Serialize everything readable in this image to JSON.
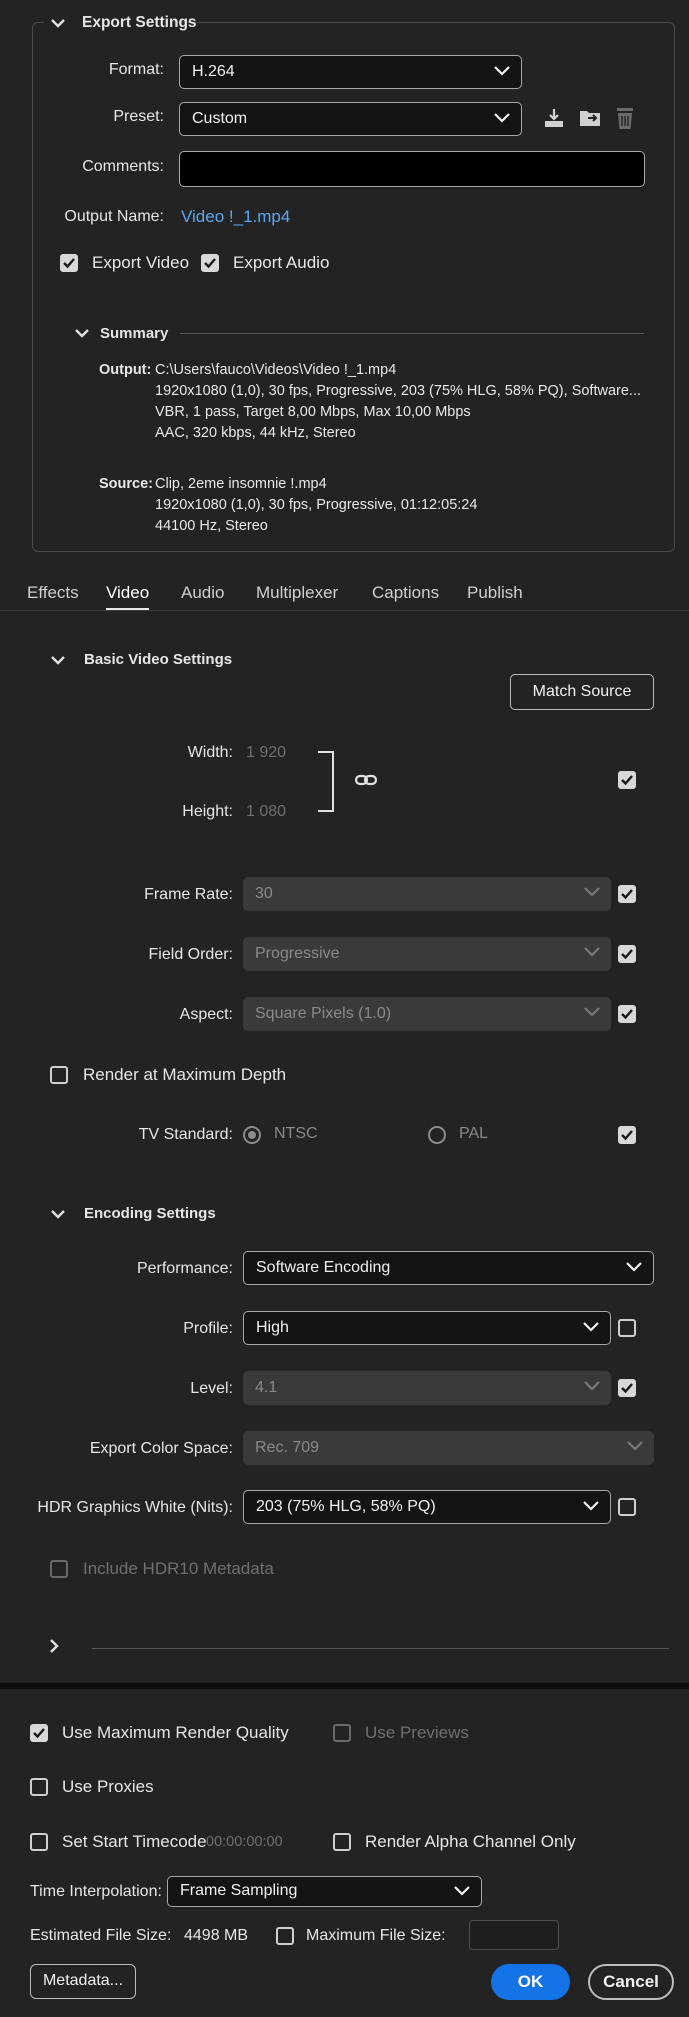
{
  "export_settings": {
    "title": "Export Settings",
    "format_label": "Format:",
    "format_value": "H.264",
    "preset_label": "Preset:",
    "preset_value": "Custom",
    "comments_label": "Comments:",
    "comments_value": "",
    "output_name_label": "Output Name:",
    "output_name_value": "Video !_1.mp4",
    "export_video_label": "Export Video",
    "export_video_checked": true,
    "export_audio_label": "Export Audio",
    "export_audio_checked": true,
    "summary": {
      "title": "Summary",
      "output_label": "Output:",
      "output_lines": [
        "C:\\Users\\fauco\\Videos\\Video !_1.mp4",
        "1920x1080 (1,0), 30 fps, Progressive, 203 (75% HLG, 58% PQ), Software...",
        "VBR, 1 pass, Target 8,00 Mbps, Max 10,00 Mbps",
        "AAC, 320 kbps, 44 kHz, Stereo"
      ],
      "source_label": "Source:",
      "source_lines": [
        "Clip, 2eme insomnie !.mp4",
        "1920x1080 (1,0), 30 fps, Progressive, 01:12:05:24",
        "44100 Hz, Stereo"
      ]
    }
  },
  "tabs": [
    {
      "label": "Effects",
      "active": false
    },
    {
      "label": "Video",
      "active": true
    },
    {
      "label": "Audio",
      "active": false
    },
    {
      "label": "Multiplexer",
      "active": false
    },
    {
      "label": "Captions",
      "active": false
    },
    {
      "label": "Publish",
      "active": false
    }
  ],
  "basic_video": {
    "title": "Basic Video Settings",
    "match_source_label": "Match Source",
    "width_label": "Width:",
    "width_value": "1 920",
    "height_label": "Height:",
    "height_value": "1 080",
    "frame_rate_label": "Frame Rate:",
    "frame_rate_value": "30",
    "field_order_label": "Field Order:",
    "field_order_value": "Progressive",
    "aspect_label": "Aspect:",
    "aspect_value": "Square Pixels (1.0)",
    "render_max_depth_label": "Render at Maximum Depth",
    "tv_standard_label": "TV Standard:",
    "ntsc_label": "NTSC",
    "pal_label": "PAL"
  },
  "encoding": {
    "title": "Encoding Settings",
    "performance_label": "Performance:",
    "performance_value": "Software Encoding",
    "profile_label": "Profile:",
    "profile_value": "High",
    "level_label": "Level:",
    "level_value": "4.1",
    "color_space_label": "Export Color Space:",
    "color_space_value": "Rec. 709",
    "hdr_white_label": "HDR Graphics White (Nits):",
    "hdr_white_value": "203 (75% HLG, 58% PQ)",
    "hdr10_label": "Include HDR10 Metadata"
  },
  "bottom": {
    "use_max_render_label": "Use Maximum Render Quality",
    "use_previews_label": "Use Previews",
    "use_proxies_label": "Use Proxies",
    "set_start_tc_label": "Set Start Timecode",
    "start_tc_value": "00:00:00:00",
    "render_alpha_label": "Render Alpha Channel Only",
    "time_interp_label": "Time Interpolation:",
    "time_interp_value": "Frame Sampling",
    "est_size_label": "Estimated File Size:",
    "est_size_value": "4498 MB",
    "max_file_size_label": "Maximum File Size:",
    "metadata_label": "Metadata...",
    "ok_label": "OK",
    "cancel_label": "Cancel"
  },
  "colors": {
    "background": "#232323",
    "accent_blue": "#1473e6",
    "link_blue": "#5aa7f0"
  }
}
